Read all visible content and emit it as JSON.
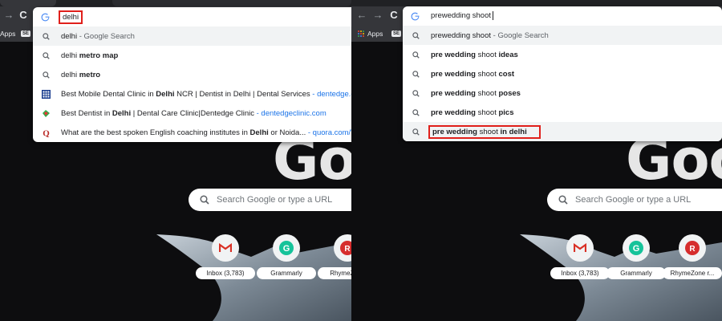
{
  "colors": {
    "highlight_box": "#e0201b",
    "link": "#1a73e8",
    "gmail_red": "#d93025",
    "grammarly_green": "#15c39a",
    "rhymezone_red": "#d62d2d"
  },
  "left": {
    "bookmarks": {
      "apps_label": "Apps",
      "se_label": "SE"
    },
    "omnibox_text": "delhi",
    "suggestions": [
      {
        "icon": "search-icon",
        "pre": "delhi",
        "bold": "",
        "post": "",
        "suffix": " - Google Search",
        "url": ""
      },
      {
        "icon": "search-icon",
        "pre": "delhi ",
        "bold": "metro map",
        "post": "",
        "suffix": "",
        "url": ""
      },
      {
        "icon": "search-icon",
        "pre": "delhi ",
        "bold": "metro",
        "post": "",
        "suffix": "",
        "url": ""
      },
      {
        "icon": "site-grid-icon",
        "pre": "Best Mobile Dental Clinic in ",
        "bold": "Delhi",
        "post": " NCR | Dentist in Delhi | Dental Services",
        "suffix": "",
        "url": " - dentedge.com"
      },
      {
        "icon": "dental-leaf-icon",
        "pre": "Best Dentist in ",
        "bold": "Delhi",
        "post": " | Dental Care Clinic|Dentedge Clinic",
        "suffix": "",
        "url": " - dentedgeclinic.com"
      },
      {
        "icon": "quora-icon",
        "pre": "What are the best spoken English coaching institutes in ",
        "bold": "Delhi",
        "post": " or Noida...",
        "suffix": "",
        "url": " - quora.com/W"
      }
    ],
    "search_placeholder": "Search Google or type a URL",
    "logo_text": "Goo",
    "shortcuts": [
      {
        "icon": "gmail-icon",
        "label": "Inbox (3,783)"
      },
      {
        "icon": "grammarly-icon",
        "label": "Grammarly"
      },
      {
        "icon": "rhymezone-icon",
        "label": "RhymeZone"
      }
    ]
  },
  "right": {
    "bookmarks": {
      "apps_label": "Apps",
      "se_label": "SE"
    },
    "omnibox_text": "prewedding shoot",
    "suggestions": [
      {
        "pre": "prewedding shoot",
        "bold": "",
        "suffix": " - Google Search"
      },
      {
        "pre": "",
        "bold": "pre wedding",
        "mid": " shoot ",
        "bold2": "ideas",
        "suffix": ""
      },
      {
        "pre": "",
        "bold": "pre wedding",
        "mid": " shoot ",
        "bold2": "cost",
        "suffix": ""
      },
      {
        "pre": "",
        "bold": "pre wedding",
        "mid": " shoot ",
        "bold2": "poses",
        "suffix": ""
      },
      {
        "pre": "",
        "bold": "pre wedding",
        "mid": " shoot ",
        "bold2": "pics",
        "suffix": ""
      },
      {
        "pre": "",
        "bold": "pre wedding",
        "mid": " shoot ",
        "bold2": "in delhi",
        "suffix": ""
      }
    ],
    "search_placeholder": "Search Google or type a URL",
    "logo_text": "Goog",
    "shortcuts": [
      {
        "icon": "gmail-icon",
        "label": "Inbox (3,783)"
      },
      {
        "icon": "grammarly-icon",
        "label": "Grammarly"
      },
      {
        "icon": "rhymezone-icon",
        "label": "RhymeZone r..."
      }
    ]
  }
}
